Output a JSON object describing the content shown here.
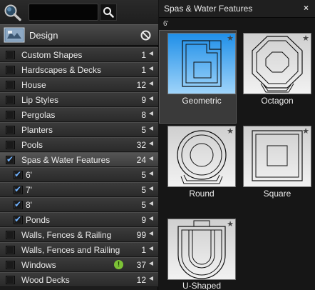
{
  "search": {
    "value": "",
    "placeholder": ""
  },
  "design": {
    "title": "Design"
  },
  "categories": [
    {
      "label": "Custom Shapes",
      "count": "1",
      "checked": false,
      "indent": false
    },
    {
      "label": "Hardscapes & Decks",
      "count": "1",
      "checked": false,
      "indent": false
    },
    {
      "label": "House",
      "count": "12",
      "checked": false,
      "indent": false
    },
    {
      "label": "Lip Styles",
      "count": "9",
      "checked": false,
      "indent": false
    },
    {
      "label": "Pergolas",
      "count": "8",
      "checked": false,
      "indent": false
    },
    {
      "label": "Planters",
      "count": "5",
      "checked": false,
      "indent": false
    },
    {
      "label": "Pools",
      "count": "32",
      "checked": false,
      "indent": false
    },
    {
      "label": "Spas & Water Features",
      "count": "24",
      "checked": true,
      "indent": false,
      "selected": true
    },
    {
      "label": "6'",
      "count": "5",
      "checked": true,
      "indent": true
    },
    {
      "label": "7'",
      "count": "5",
      "checked": true,
      "indent": true
    },
    {
      "label": "8'",
      "count": "5",
      "checked": true,
      "indent": true
    },
    {
      "label": "Ponds",
      "count": "9",
      "checked": true,
      "indent": true
    },
    {
      "label": "Walls, Fences & Railing",
      "count": "99",
      "checked": false,
      "indent": false
    },
    {
      "label": "Walls, Fences and Railing",
      "count": "1",
      "checked": false,
      "indent": false
    },
    {
      "label": "Windows",
      "count": "37",
      "checked": false,
      "indent": false,
      "warning": true
    },
    {
      "label": "Wood Decks",
      "count": "12",
      "checked": false,
      "indent": false
    }
  ],
  "panel": {
    "title": "Spas & Water Features",
    "close": "×",
    "subcategory": "6'",
    "tiles": [
      {
        "name": "Geometric",
        "selected": true
      },
      {
        "name": "Octagon"
      },
      {
        "name": "Round"
      },
      {
        "name": "Square"
      },
      {
        "name": "U-Shaped"
      }
    ]
  },
  "icons": {
    "magnifier": "magnifier-icon",
    "search": "search-icon",
    "no": "no-entry-icon",
    "arrow": "arrow-left-icon",
    "star": "star-icon",
    "warning": "warning-icon"
  },
  "colors": {
    "accent": "#3aa0f0",
    "check": "#6fb2ff",
    "warning": "#7cc236"
  }
}
